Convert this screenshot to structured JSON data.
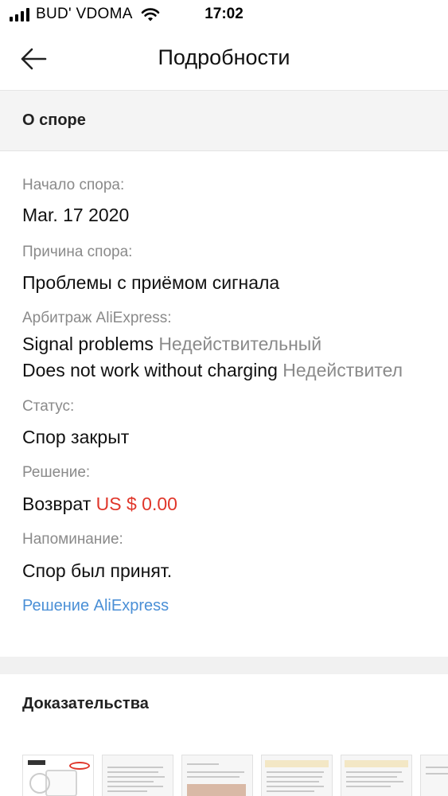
{
  "status_bar": {
    "carrier": "BUD' VDOMA",
    "time": "17:02"
  },
  "nav": {
    "title": "Подробности",
    "back_icon": "arrow-left-icon"
  },
  "dispute_section": {
    "header": "О споре",
    "start_label": "Начало спора:",
    "start_value": "Mar. 17 2020",
    "reason_label": "Причина спора:",
    "reason_value": "Проблемы с приёмом сигнала",
    "arbitration_label": "Арбитраж AliExpress:",
    "arbitration_items": [
      {
        "claim": "Signal problems",
        "verdict": "Недействительный"
      },
      {
        "claim": "Does not work without charging",
        "verdict": "Недействител"
      }
    ],
    "status_label": "Статус:",
    "status_value": "Спор закрыт",
    "decision_label": "Решение:",
    "decision_type": "Возврат",
    "decision_amount": "US $ 0.00",
    "reminder_label": "Напоминание:",
    "reminder_value": "Спор был принят.",
    "decision_link": "Решение AliExpress"
  },
  "evidence_section": {
    "header": "Доказательства",
    "thumbnails": [
      "evidence-photo-1",
      "evidence-screenshot-2",
      "evidence-screenshot-3",
      "evidence-screenshot-4",
      "evidence-screenshot-5",
      "evidence-screenshot-6"
    ]
  },
  "colors": {
    "accent_red": "#e0362a",
    "link_blue": "#4a8fd6",
    "muted_gray": "#8a8a8a"
  }
}
